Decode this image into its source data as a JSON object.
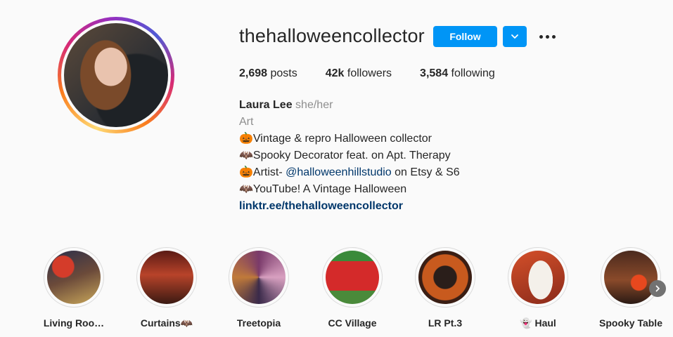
{
  "profile": {
    "username": "thehalloweencollector",
    "follow_label": "Follow",
    "accent": "#0095f6"
  },
  "stats": {
    "posts_count": "2,698",
    "posts_label": "posts",
    "followers_count": "42k",
    "followers_label": "followers",
    "following_count": "3,584",
    "following_label": "following"
  },
  "bio": {
    "name": "Laura Lee",
    "pronouns": "she/her",
    "category": "Art",
    "line1": "🎃Vintage & repro Halloween collector",
    "line2": "🦇Spooky Decorator feat. on Apt. Therapy",
    "line3_prefix": "🎃Artist- ",
    "line3_mention": "@halloweenhillstudio",
    "line3_suffix": " on Etsy & S6",
    "line4": "🦇YouTube! A Vintage Halloween",
    "link": "linktr.ee/thehalloweencollector"
  },
  "highlights": [
    {
      "label": "Living Roo…",
      "image": "living-room-thumbnail"
    },
    {
      "label": "Curtains🦇",
      "image": "curtains-thumbnail"
    },
    {
      "label": "Treetopia",
      "image": "treetopia-thumbnail"
    },
    {
      "label": "CC Village",
      "image": "cc-village-thumbnail"
    },
    {
      "label": "LR Pt.3",
      "image": "lr-pt3-thumbnail"
    },
    {
      "label": "👻 Haul",
      "image": "haul-thumbnail"
    },
    {
      "label": "Spooky Table",
      "image": "spooky-table-thumbnail"
    }
  ]
}
